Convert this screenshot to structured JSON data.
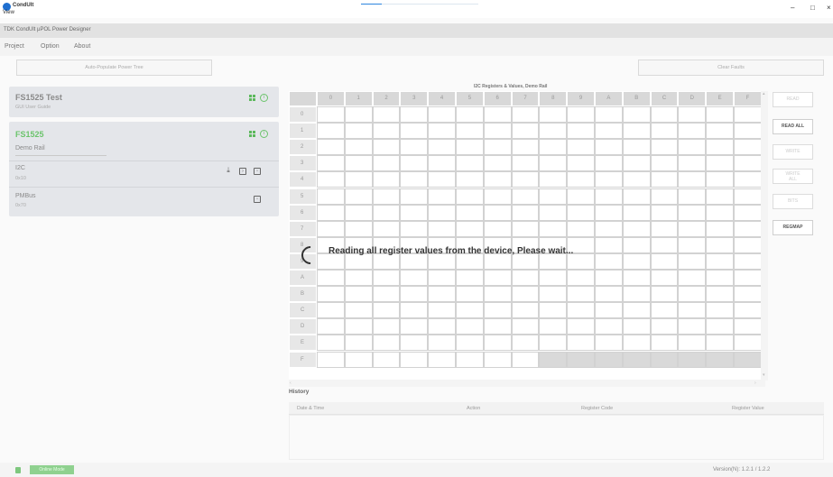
{
  "window": {
    "app_name": "CondUlt",
    "view_menu": "View",
    "minimize": "–",
    "maximize": "□",
    "close": "×",
    "load_progress": 0.18
  },
  "header": {
    "title": "TDK CondUlt µPOL Power Designer"
  },
  "menu": {
    "items": [
      "Project",
      "Option",
      "About"
    ]
  },
  "toolbar": {
    "auto_populate": "Auto-Populate Power Tree",
    "clear_faults": "Clear Faults"
  },
  "project_card": {
    "title": "FS1525 Test",
    "subtitle": "GUI User Guide"
  },
  "device_card": {
    "title": "FS1525",
    "rail_name": "Demo Rail",
    "buses": [
      {
        "name": "I2C",
        "address": "0x10"
      },
      {
        "name": "PMBus",
        "address": "0x70"
      }
    ]
  },
  "grid": {
    "title": "I2C Registers & Values, Demo Rail",
    "column_headers": [
      "0",
      "1",
      "2",
      "3",
      "4",
      "5",
      "6",
      "7",
      "8",
      "9",
      "A",
      "B",
      "C",
      "D",
      "E",
      "F"
    ],
    "row_headers": [
      "0",
      "1",
      "2",
      "3",
      "4",
      "5",
      "6",
      "7",
      "8",
      "9",
      "A",
      "B",
      "C",
      "D",
      "E",
      "F"
    ],
    "shaded_last_row_from": 8
  },
  "side_buttons": [
    {
      "label": "READ",
      "active": false
    },
    {
      "label": "READ ALL",
      "active": true
    },
    {
      "label": "WRITE",
      "active": false
    },
    {
      "label": "WRITE\nALL",
      "active": false
    },
    {
      "label": "BITS",
      "active": false
    },
    {
      "label": "REGMAP",
      "active": true
    }
  ],
  "loading": {
    "message": "Reading all register values from the device, Please wait..."
  },
  "history": {
    "title": "History",
    "columns": [
      "Date & Time",
      "Action",
      "Register Code",
      "Register Value"
    ]
  },
  "status": {
    "badge": "Online Mode",
    "version": "Version(N): 1.2.1 / 1.2.2"
  },
  "colors": {
    "accent_green": "#5cb85c",
    "logo_blue": "#1e6fd0"
  }
}
